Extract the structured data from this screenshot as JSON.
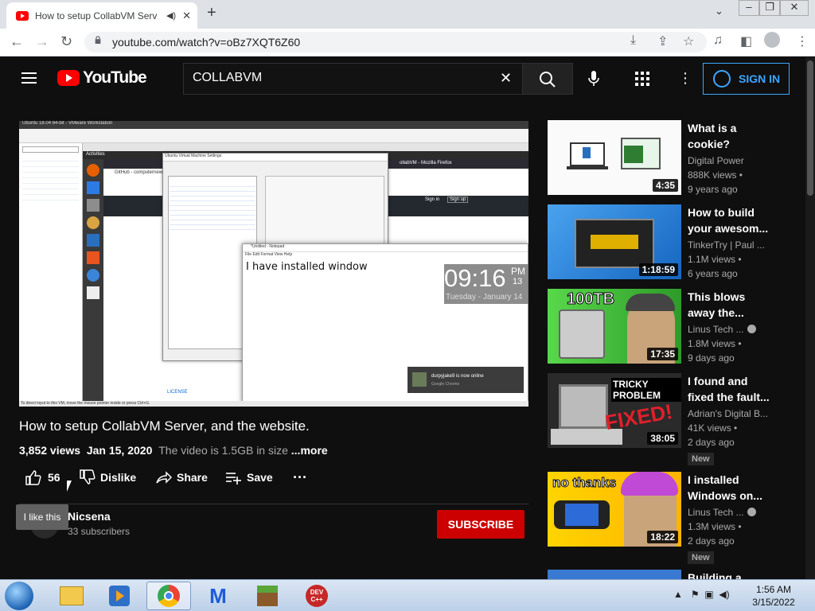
{
  "browser": {
    "tab_title": "How to setup CollabVM Serv",
    "url": "youtube.com/watch?v=oBz7XQT6Z60"
  },
  "youtube": {
    "logo_text": "YouTube",
    "search_value": "COLLABVM",
    "sign_in_label": "SIGN IN"
  },
  "video": {
    "title": "How to setup CollabVM Server, and the website.",
    "views": "3,852 views",
    "date": "Jan 15, 2020",
    "description_snippet": "The video is 1.5GB in size",
    "more_label": "...more",
    "like_count": "56",
    "dislike_label": "Dislike",
    "share_label": "Share",
    "save_label": "Save",
    "tooltip": "I like this",
    "channel_name": "Nicsena",
    "subscribers": "33 subscribers",
    "subscribe_label": "SUBSCRIBE"
  },
  "player_frame": {
    "notepad_title": "*Untitled - Notepad",
    "notepad_menu": "File  Edit  Format  View  Help",
    "notepad_text": "I have installed window",
    "clock_time": "09:16",
    "clock_ampm": "PM",
    "clock_sec": "13",
    "clock_date": "Tuesday - January 14",
    "firefox_title": "ollabVM - Mozilla Firefox",
    "notification_title": "durpyjake9 is now online",
    "notification_sub": "Google Chrome",
    "dialog_title": "Ubuntu Virtual Machine Settings",
    "github_text": "GitHub - computernewb",
    "sign_in_btn": "Sign in",
    "sign_up_btn": "Sign up",
    "license_text": "LICENSE",
    "status_bar": "To direct input to this VM, move the mouse pointer inside or press Ctrl+G.",
    "vmware_title": "Ubuntu 18.04 64-bit - VMware Workstation",
    "activities": "Activities"
  },
  "recommendations": [
    {
      "title": "What is a cookie?",
      "channel": "Digital Power",
      "views": "888K views",
      "age": "9 years ago",
      "duration": "4:35",
      "verified": false,
      "badge": ""
    },
    {
      "title": "How to build your awesom...",
      "channel": "TinkerTry | Paul ...",
      "views": "1.1M views",
      "age": "6 years ago",
      "duration": "1:18:59",
      "verified": false,
      "badge": ""
    },
    {
      "title": "This blows away the...",
      "channel": "Linus Tech ...",
      "views": "1.8M views",
      "age": "9 days ago",
      "duration": "17:35",
      "verified": true,
      "badge": "",
      "thumb_text": "100TB"
    },
    {
      "title": "I found and fixed the fault...",
      "channel": "Adrian's Digital B...",
      "views": "41K views",
      "age": "2 days ago",
      "duration": "38:05",
      "verified": false,
      "badge": "New",
      "thumb_text": "TRICKY PROBLEM",
      "thumb_text2": "FIXED!"
    },
    {
      "title": "I installed Windows on...",
      "channel": "Linus Tech ...",
      "views": "1.3M views",
      "age": "2 days ago",
      "duration": "18:22",
      "verified": true,
      "badge": "New",
      "thumb_text": "no thanks"
    },
    {
      "title": "Building a",
      "channel": "",
      "views": "",
      "age": "",
      "duration": "",
      "verified": false,
      "badge": ""
    }
  ],
  "taskbar": {
    "time": "1:56 AM",
    "date": "3/15/2022",
    "apps": [
      "explorer",
      "media-player",
      "chrome",
      "malwarebytes",
      "minecraft",
      "dev-cpp"
    ],
    "devcpp_label": "DEV C++"
  }
}
